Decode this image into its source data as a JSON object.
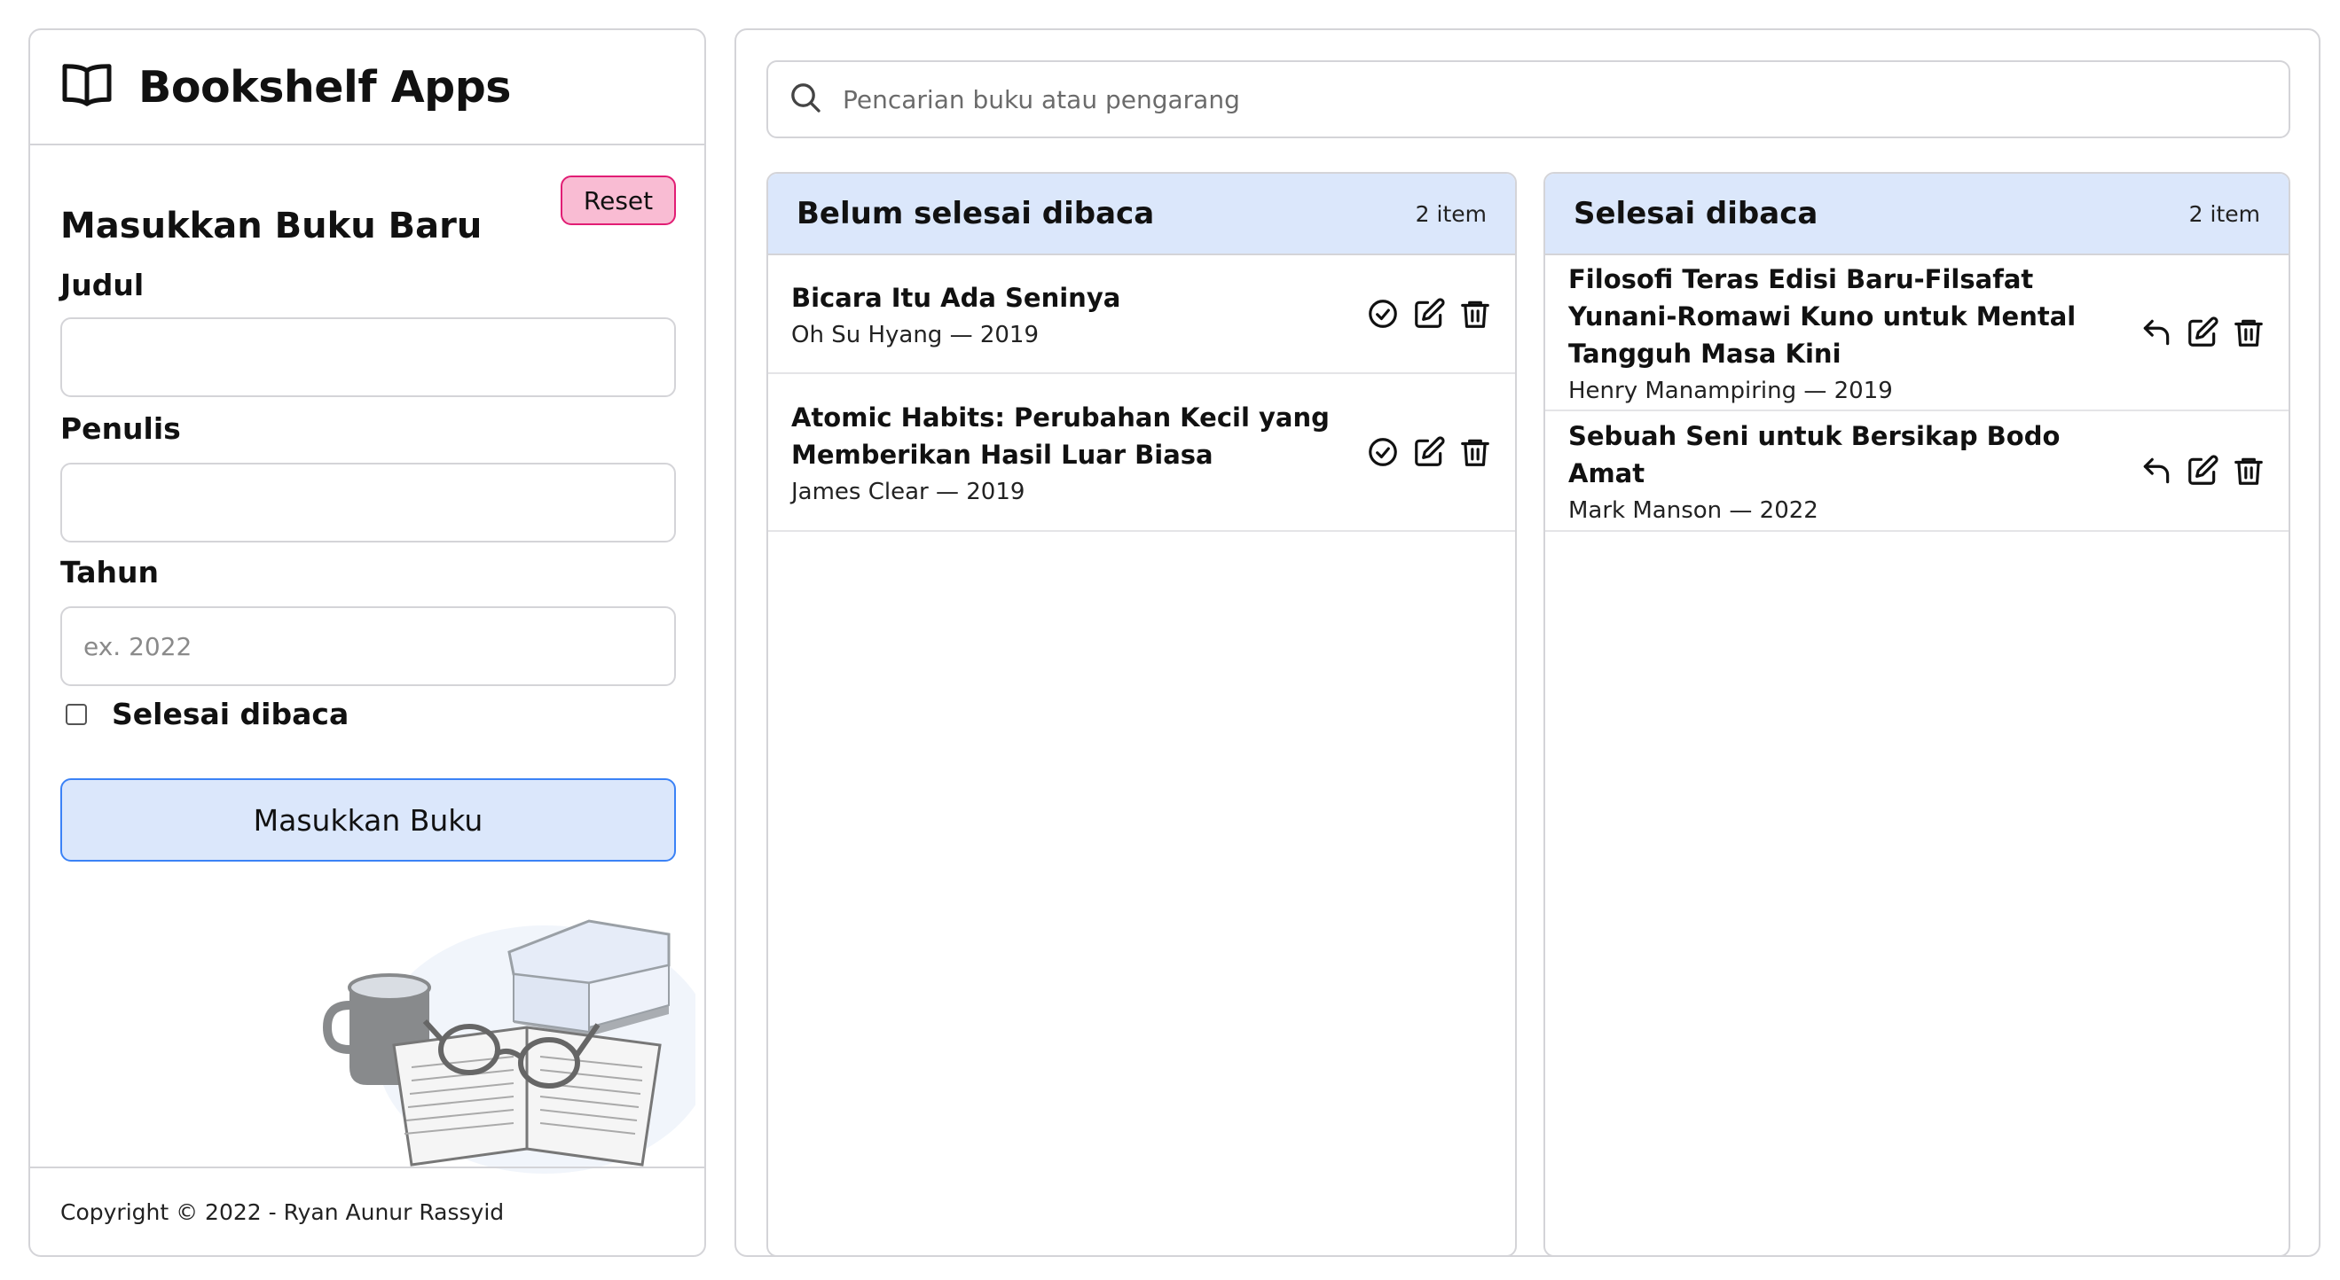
{
  "app": {
    "title": "Bookshelf Apps"
  },
  "form": {
    "heading": "Masukkan Buku Baru",
    "reset_label": "Reset",
    "title_label": "Judul",
    "title_value": "",
    "author_label": "Penulis",
    "author_value": "",
    "year_label": "Tahun",
    "year_placeholder": "ex. 2022",
    "finished_label": "Selesai dibaca",
    "finished_checked": false,
    "submit_label": "Masukkan Buku"
  },
  "footer": {
    "text": "Copyright © 2022 - Ryan Aunur Rassyid"
  },
  "search": {
    "placeholder": "Pencarian buku atau pengarang"
  },
  "unread": {
    "title": "Belum selesai dibaca",
    "count": "2 item",
    "books": [
      {
        "title": "Bicara Itu Ada Seninya",
        "meta": "Oh Su Hyang — 2019"
      },
      {
        "title": "Atomic Habits: Perubahan Kecil yang Memberikan Hasil Luar Biasa",
        "meta": "James Clear — 2019"
      }
    ]
  },
  "read": {
    "title": "Selesai dibaca",
    "count": "2 item",
    "books": [
      {
        "title": "Filosofi Teras Edisi Baru-Filsafat Yunani-Romawi Kuno untuk Mental Tangguh Masa Kini",
        "meta": "Henry Manampiring — 2019"
      },
      {
        "title": "Sebuah Seni untuk Bersikap Bodo Amat",
        "meta": "Mark Manson — 2022"
      }
    ]
  },
  "icons": {
    "brand": "book-open-icon",
    "search": "search-icon",
    "mark_finished": "check-circle-icon",
    "mark_unfinished": "undo-arrow-icon",
    "edit": "edit-icon",
    "delete": "trash-icon"
  },
  "colors": {
    "header_bg": "#dbe7fb",
    "submit_border": "#3b82f6",
    "reset_bg": "#f9bcd3",
    "reset_border": "#e11d74",
    "border": "#d4d4d8"
  }
}
